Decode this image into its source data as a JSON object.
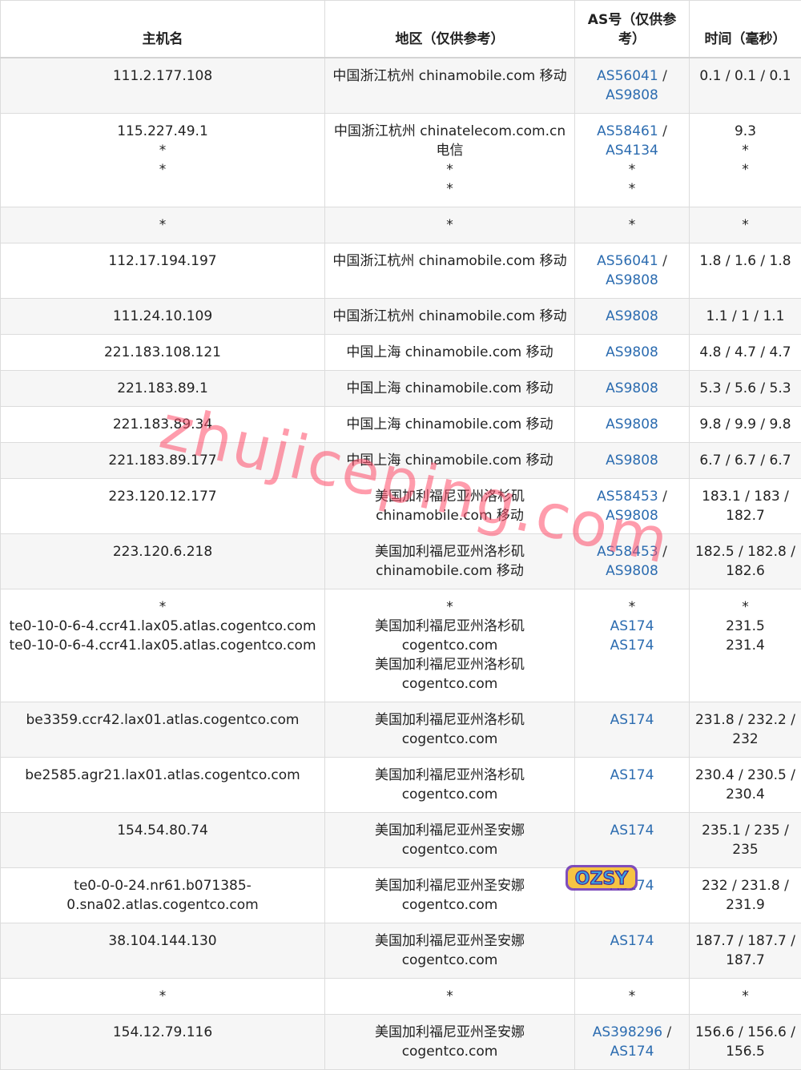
{
  "headers": {
    "host": "主机名",
    "region": "地区（仅供参考）",
    "as": "AS号（仅供参考）",
    "time": "时间（毫秒）"
  },
  "rows": [
    {
      "host": [
        "111.2.177.108"
      ],
      "region": [
        "中国浙江杭州 chinamobile.com 移动"
      ],
      "as": [
        [
          "AS56041",
          "AS9808"
        ]
      ],
      "time": [
        "0.1 / 0.1 / 0.1"
      ]
    },
    {
      "host": [
        "115.227.49.1",
        "*",
        "*"
      ],
      "region": [
        "中国浙江杭州 chinatelecom.com.cn 电信",
        "*",
        "*"
      ],
      "as": [
        [
          "AS58461",
          "AS4134"
        ],
        "*",
        "*"
      ],
      "time": [
        "9.3",
        "*",
        "*"
      ]
    },
    {
      "host": [
        "*"
      ],
      "region": [
        "*"
      ],
      "as": [
        "*"
      ],
      "time": [
        "*"
      ]
    },
    {
      "host": [
        "112.17.194.197"
      ],
      "region": [
        "中国浙江杭州 chinamobile.com 移动"
      ],
      "as": [
        [
          "AS56041",
          "AS9808"
        ]
      ],
      "time": [
        "1.8 / 1.6 / 1.8"
      ]
    },
    {
      "host": [
        "111.24.10.109"
      ],
      "region": [
        "中国浙江杭州 chinamobile.com 移动"
      ],
      "as": [
        [
          "AS9808"
        ]
      ],
      "time": [
        "1.1 / 1 / 1.1"
      ]
    },
    {
      "host": [
        "221.183.108.121"
      ],
      "region": [
        "中国上海 chinamobile.com 移动"
      ],
      "as": [
        [
          "AS9808"
        ]
      ],
      "time": [
        "4.8 / 4.7 / 4.7"
      ]
    },
    {
      "host": [
        "221.183.89.1"
      ],
      "region": [
        "中国上海 chinamobile.com 移动"
      ],
      "as": [
        [
          "AS9808"
        ]
      ],
      "time": [
        "5.3 / 5.6 / 5.3"
      ]
    },
    {
      "host": [
        "221.183.89.34"
      ],
      "region": [
        "中国上海 chinamobile.com 移动"
      ],
      "as": [
        [
          "AS9808"
        ]
      ],
      "time": [
        "9.8 / 9.9 / 9.8"
      ]
    },
    {
      "host": [
        "221.183.89.177"
      ],
      "region": [
        "中国上海 chinamobile.com 移动"
      ],
      "as": [
        [
          "AS9808"
        ]
      ],
      "time": [
        "6.7 / 6.7 / 6.7"
      ]
    },
    {
      "host": [
        "223.120.12.177"
      ],
      "region": [
        "美国加利福尼亚州洛杉矶 chinamobile.com 移动"
      ],
      "as": [
        [
          "AS58453",
          "AS9808"
        ]
      ],
      "time": [
        "183.1 / 183 / 182.7"
      ]
    },
    {
      "host": [
        "223.120.6.218"
      ],
      "region": [
        "美国加利福尼亚州洛杉矶 chinamobile.com 移动"
      ],
      "as": [
        [
          "AS58453",
          "AS9808"
        ]
      ],
      "time": [
        "182.5 / 182.8 / 182.6"
      ]
    },
    {
      "host": [
        "*",
        "te0-10-0-6-4.ccr41.lax05.atlas.cogentco.com",
        "te0-10-0-6-4.ccr41.lax05.atlas.cogentco.com"
      ],
      "region": [
        "*",
        "美国加利福尼亚州洛杉矶 cogentco.com",
        "美国加利福尼亚州洛杉矶 cogentco.com"
      ],
      "as": [
        "*",
        [
          "AS174"
        ],
        [
          "AS174"
        ]
      ],
      "time": [
        "*",
        "231.5",
        "231.4"
      ]
    },
    {
      "host": [
        "be3359.ccr42.lax01.atlas.cogentco.com"
      ],
      "region": [
        "美国加利福尼亚州洛杉矶 cogentco.com"
      ],
      "as": [
        [
          "AS174"
        ]
      ],
      "time": [
        "231.8 / 232.2 / 232"
      ]
    },
    {
      "host": [
        "be2585.agr21.lax01.atlas.cogentco.com"
      ],
      "region": [
        "美国加利福尼亚州洛杉矶 cogentco.com"
      ],
      "as": [
        [
          "AS174"
        ]
      ],
      "time": [
        "230.4 / 230.5 / 230.4"
      ]
    },
    {
      "host": [
        "154.54.80.74"
      ],
      "region": [
        "美国加利福尼亚州圣安娜 cogentco.com"
      ],
      "as": [
        [
          "AS174"
        ]
      ],
      "time": [
        "235.1 / 235 / 235"
      ]
    },
    {
      "host": [
        "te0-0-0-24.nr61.b071385-0.sna02.atlas.cogentco.com"
      ],
      "region": [
        "美国加利福尼亚州圣安娜 cogentco.com"
      ],
      "as": [
        [
          "AS174"
        ]
      ],
      "time": [
        "232 / 231.8 / 231.9"
      ]
    },
    {
      "host": [
        "38.104.144.130"
      ],
      "region": [
        "美国加利福尼亚州圣安娜 cogentco.com"
      ],
      "as": [
        [
          "AS174"
        ]
      ],
      "time": [
        "187.7 / 187.7 / 187.7"
      ]
    },
    {
      "host": [
        "*"
      ],
      "region": [
        "*"
      ],
      "as": [
        "*"
      ],
      "time": [
        "*"
      ]
    },
    {
      "host": [
        "154.12.79.116"
      ],
      "region": [
        "美国加利福尼亚州圣安娜 cogentco.com"
      ],
      "as": [
        [
          "AS398296",
          "AS174"
        ]
      ],
      "time": [
        "156.6 / 156.6 / 156.5"
      ]
    }
  ],
  "watermark": "zhujiceping.com",
  "badge": "OZSY",
  "colors": {
    "link": "#2c6cb0",
    "watermark": "#ff4d6a",
    "row_alt": "#f6f6f6",
    "border": "#dcdcdc"
  }
}
